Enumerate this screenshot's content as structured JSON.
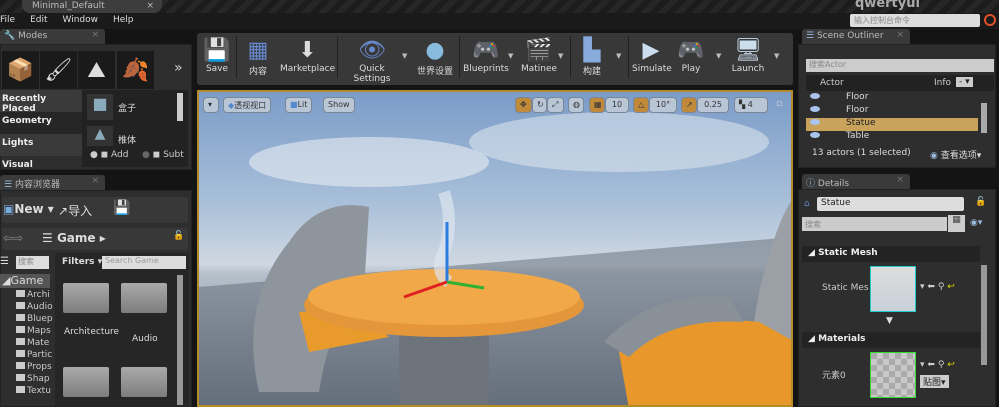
{
  "window": {
    "tab": "Minimal_Default",
    "title": "qwertyui"
  },
  "menu": [
    "File",
    "Edit",
    "Window",
    "Help"
  ],
  "console": {
    "placeholder": "输入控制台命令"
  },
  "modes": {
    "tab": "Modes",
    "categories": [
      "Recently Placed",
      "Geometry",
      "Lights",
      "Visual"
    ],
    "items": [
      "盒子",
      "椎体"
    ],
    "add": "Add",
    "subtract": "Subt"
  },
  "toolbar": [
    "Save",
    "内容",
    "Marketplace",
    "Quick Settings",
    "世界设置",
    "Blueprints",
    "Matinee",
    "构建",
    "Simulate",
    "Play",
    "Launch"
  ],
  "viewport": {
    "menu": "透视视口",
    "lit": "Lit",
    "show": "Show",
    "grid": "10",
    "rot": "10°",
    "scale": "0.25",
    "speed": "4"
  },
  "content": {
    "tab": "内容浏览器",
    "new": "New",
    "import": "导入",
    "path": "Game",
    "search_tree": "搜索",
    "filters": "Filters",
    "search": "Search Game",
    "tree": [
      "Game",
      "Archi",
      "Audio",
      "Bluep",
      "Maps",
      "Mate",
      "Partic",
      "Props",
      "Shap",
      "Textu"
    ],
    "folders": [
      "Architecture",
      "Audio"
    ]
  },
  "outliner": {
    "tab": "Scene Outliner",
    "search": "搜索Actor",
    "col_actor": "Actor",
    "col_info": "Info",
    "rows": [
      "Floor",
      "Floor",
      "Statue",
      "Table"
    ],
    "selected": 2,
    "status": "13 actors (1 selected)",
    "view": "查看选项"
  },
  "details": {
    "tab": "Details",
    "name": "Statue",
    "search": "搜索",
    "static_mesh": "Static Mesh",
    "static_mesh_label": "Static Mes",
    "materials": "Materials",
    "element": "元素0",
    "texture": "贴图"
  }
}
